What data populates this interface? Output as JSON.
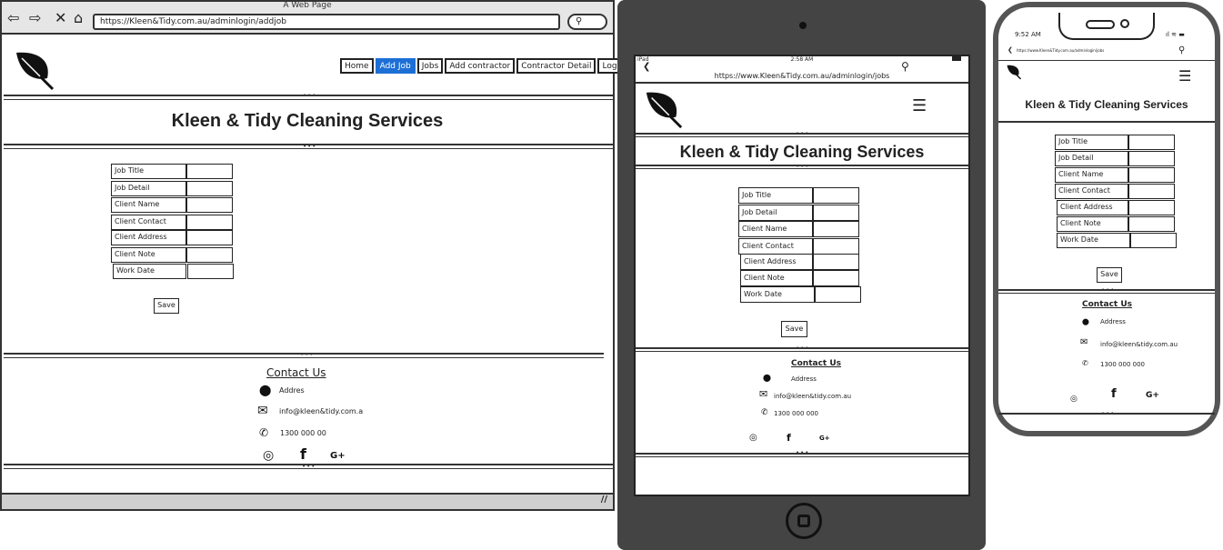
{
  "desktop": {
    "window_title": "A Web Page",
    "url": "https://Kleen&Tidy.com.au/adminlogin/addjob",
    "nav": [
      "Home",
      "Add Job",
      "Jobs",
      "Add contractor",
      "Contractor Detail",
      "Log Out"
    ],
    "active_nav": "Add Job",
    "site_title": "Kleen & Tidy Cleaning Services",
    "fields": [
      "Job Title",
      "Job Detail",
      "Client Name",
      "Client Contact",
      "Client Address",
      "Client Note",
      "Work Date"
    ],
    "save_label": "Save",
    "contact": {
      "title": "Contact Us",
      "address": "Addres",
      "email": "info@kleen&tidy.com.a",
      "phone": "1300 000 00"
    },
    "social": {
      "instagram": "◎",
      "facebook": "f",
      "google": "G+"
    },
    "resize_glyph": "//"
  },
  "tablet": {
    "status": {
      "left": "iPad",
      "time": "2:58 AM"
    },
    "url": "https://www.Kleen&Tidy.com.au/adminlogin/jobs",
    "site_title": "Kleen & Tidy Cleaning Services",
    "fields": [
      "Job Title",
      "Job Detail",
      "Client Name",
      "Client Contact",
      "Client Address",
      "Client Note",
      "Work Date"
    ],
    "save_label": "Save",
    "contact": {
      "title": "Contact Us",
      "address": "Address",
      "email": "info@kleen&tidy.com.au",
      "phone": "1300 000 000"
    },
    "social": {
      "instagram": "◎",
      "facebook": "f",
      "google": "G+"
    }
  },
  "phone": {
    "status": {
      "time": "9:52 AM"
    },
    "url": "https://www.Kleen&Tidy.com.au/adminlogin/jobs",
    "site_title": "Kleen & Tidy Cleaning Services",
    "fields": [
      "Job Title",
      "Job Detail",
      "Client Name",
      "Client Contact",
      "Client Address",
      "Client Note",
      "Work Date"
    ],
    "save_label": "Save",
    "contact": {
      "title": "Contact Us",
      "address": "Address",
      "email": "info@kleen&tidy.com.au",
      "phone": "1300 000 000"
    },
    "social": {
      "instagram": "◎",
      "facebook": "f",
      "google": "G+"
    }
  },
  "glyphs": {
    "back": "⇦",
    "forward": "⇨",
    "stop": "✕",
    "home": "⌂",
    "menu": "☰",
    "search": "⚲"
  }
}
